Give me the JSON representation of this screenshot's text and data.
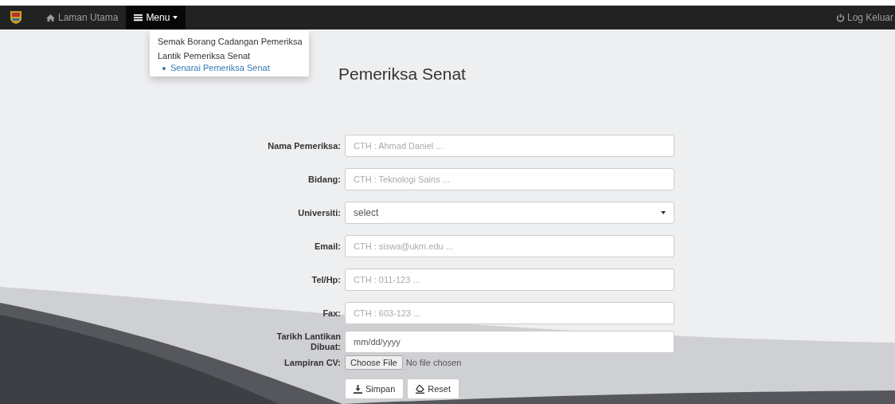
{
  "navbar": {
    "items": [
      {
        "label": "Laman Utama",
        "kind": "home"
      },
      {
        "label": "Menu",
        "kind": "menu",
        "expanded": true
      }
    ],
    "logout": "Log Keluar"
  },
  "dropdown": {
    "items": [
      {
        "label": "Semak Borang Cadangan Pemeriksa"
      },
      {
        "label": "Lantik Pemeriksa Senat",
        "children": [
          {
            "label": "Senarai Pemeriksa Senat"
          }
        ]
      }
    ]
  },
  "title": "Pemeriksa Senat",
  "form": {
    "fields": [
      {
        "label": "Nama Pemeriksa:",
        "kind": "text",
        "placeholder": "CTH : Ahmad Daniel ..."
      },
      {
        "label": "Bidang:",
        "kind": "text",
        "placeholder": "CTH : Teknologi Sains ..."
      },
      {
        "label": "Universiti:",
        "kind": "select",
        "value": "select"
      },
      {
        "label": "Email:",
        "kind": "text",
        "placeholder": "CTH : siswa@ukm.edu ..."
      },
      {
        "label": "Tel/Hp:",
        "kind": "text",
        "placeholder": "CTH : 011-123 ..."
      },
      {
        "label": "Fax:",
        "kind": "text",
        "placeholder": "CTH : 603-123 ..."
      },
      {
        "label": "Tarikh Lantikan Dibuat:",
        "kind": "date",
        "placeholder": "mm/dd/yyyy"
      },
      {
        "label": "Lampiran CV:",
        "kind": "file",
        "button": "Choose File",
        "status": "No file chosen"
      }
    ],
    "buttons": [
      {
        "label": "Simpan",
        "kind": "save"
      },
      {
        "label": "Reset",
        "kind": "reset"
      }
    ]
  }
}
